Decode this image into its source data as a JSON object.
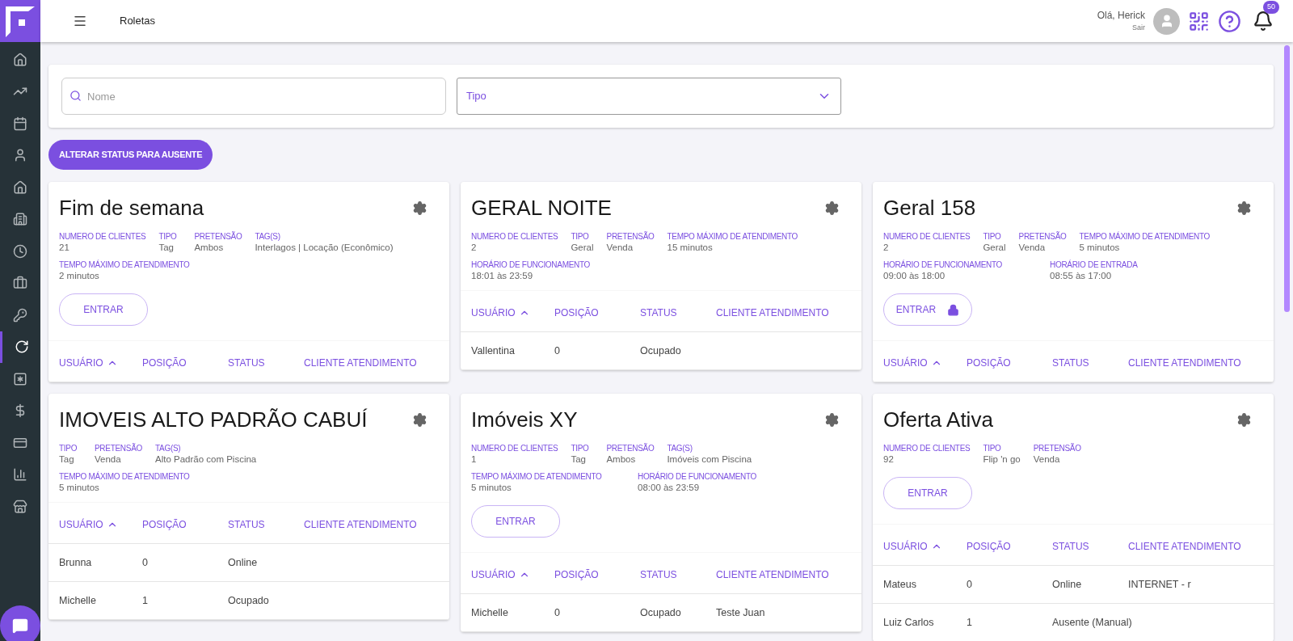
{
  "header": {
    "title": "Roletas",
    "greeting": "Olá, Herick",
    "logout": "Sair",
    "notifications": "50"
  },
  "sidebar": {
    "items": [
      {
        "selected": false
      },
      {
        "selected": false
      },
      {
        "selected": false
      },
      {
        "selected": false
      },
      {
        "selected": false
      },
      {
        "selected": false
      },
      {
        "selected": false
      },
      {
        "selected": false
      },
      {
        "selected": false
      },
      {
        "selected": true
      },
      {
        "selected": false
      },
      {
        "selected": false
      },
      {
        "selected": false
      },
      {
        "selected": false
      },
      {
        "selected": false
      }
    ]
  },
  "filters": {
    "search": {
      "placeholder": "Nome"
    },
    "type_select": {
      "placeholder": "Tipo"
    }
  },
  "status_button": "ALTERAR STATUS PARA AUSENTE",
  "cards": [
    {
      "title": "Fim de semana",
      "field_rows": [
        [
          {
            "label": "NUMERO DE CLIENTES",
            "value": "21"
          },
          {
            "label": "TIPO",
            "value": "Tag"
          },
          {
            "label": "PRETENSÃO",
            "value": "Ambos"
          },
          {
            "label": "TAG(S)",
            "value": "Interlagos | Locação (Econômico)"
          }
        ],
        [
          {
            "label": "TEMPO MÁXIMO DE ATENDIMENTO",
            "value": "2 minutos"
          }
        ]
      ],
      "enter": {
        "label": "ENTRAR",
        "locked": false
      },
      "columns": [
        {
          "label": "USUÁRIO",
          "sorted": true
        },
        {
          "label": "POSIÇÃO",
          "sorted": false
        },
        {
          "label": "STATUS",
          "sorted": false
        },
        {
          "label": "CLIENTE ATENDIMENTO",
          "sorted": false
        }
      ]
    },
    {
      "title": "GERAL NOITE",
      "field_rows": [
        [
          {
            "label": "NUMERO DE CLIENTES",
            "value": "2"
          },
          {
            "label": "TIPO",
            "value": "Geral"
          },
          {
            "label": "PRETENSÃO",
            "value": "Venda"
          },
          {
            "label": "TEMPO MÁXIMO DE ATENDIMENTO",
            "value": "15 minutos"
          }
        ],
        [
          {
            "label": "HORÁRIO DE FUNCIONAMENTO",
            "value": "18:01 às 23:59"
          }
        ]
      ],
      "columns": [
        {
          "label": "USUÁRIO",
          "sorted": true
        },
        {
          "label": "POSIÇÃO",
          "sorted": false
        },
        {
          "label": "STATUS",
          "sorted": false
        },
        {
          "label": "CLIENTE ATENDIMENTO",
          "sorted": false
        }
      ],
      "rows": [
        [
          "Vallentina",
          "0",
          "Ocupado",
          ""
        ]
      ]
    },
    {
      "title": "Geral 158",
      "field_rows": [
        [
          {
            "label": "NUMERO DE CLIENTES",
            "value": "2"
          },
          {
            "label": "TIPO",
            "value": "Geral"
          },
          {
            "label": "PRETENSÃO",
            "value": "Venda"
          },
          {
            "label": "TEMPO MÁXIMO DE ATENDIMENTO",
            "value": "5 minutos"
          }
        ],
        [
          {
            "label": "HORÁRIO DE FUNCIONAMENTO",
            "value": "09:00 às 18:00"
          },
          {
            "label": "HORÁRIO DE ENTRADA",
            "value": "08:55 às 17:00"
          }
        ]
      ],
      "enter": {
        "label": "ENTRAR",
        "locked": true
      },
      "columns": [
        {
          "label": "USUÁRIO",
          "sorted": true
        },
        {
          "label": "POSIÇÃO",
          "sorted": false
        },
        {
          "label": "STATUS",
          "sorted": false
        },
        {
          "label": "CLIENTE ATENDIMENTO",
          "sorted": false
        }
      ]
    },
    {
      "title": "IMOVEIS ALTO PADRÃO CABUÍ",
      "field_rows": [
        [
          {
            "label": "TIPO",
            "value": "Tag"
          },
          {
            "label": "PRETENSÃO",
            "value": "Venda"
          },
          {
            "label": "TAG(S)",
            "value": "Alto Padrão com Piscina"
          }
        ],
        [
          {
            "label": "TEMPO MÁXIMO DE ATENDIMENTO",
            "value": "5 minutos"
          }
        ]
      ],
      "columns": [
        {
          "label": "USUÁRIO",
          "sorted": true
        },
        {
          "label": "POSIÇÃO",
          "sorted": false
        },
        {
          "label": "STATUS",
          "sorted": false
        },
        {
          "label": "CLIENTE ATENDIMENTO",
          "sorted": false
        }
      ],
      "rows": [
        [
          "Brunna",
          "0",
          "Online",
          ""
        ],
        [
          "Michelle",
          "1",
          "Ocupado",
          ""
        ]
      ]
    },
    {
      "title": "Imóveis XY",
      "field_rows": [
        [
          {
            "label": "NUMERO DE CLIENTES",
            "value": "1"
          },
          {
            "label": "TIPO",
            "value": "Tag"
          },
          {
            "label": "PRETENSÃO",
            "value": "Ambos"
          },
          {
            "label": "TAG(S)",
            "value": "Imóveis com Piscina"
          }
        ],
        [
          {
            "label": "TEMPO MÁXIMO DE ATENDIMENTO",
            "value": "5 minutos"
          },
          {
            "label": "HORÁRIO DE FUNCIONAMENTO",
            "value": "08:00 às 23:59"
          }
        ]
      ],
      "enter": {
        "label": "ENTRAR",
        "locked": false
      },
      "columns": [
        {
          "label": "USUÁRIO",
          "sorted": true
        },
        {
          "label": "POSIÇÃO",
          "sorted": false
        },
        {
          "label": "STATUS",
          "sorted": false
        },
        {
          "label": "CLIENTE ATENDIMENTO",
          "sorted": false
        }
      ],
      "rows": [
        [
          "Michelle",
          "0",
          "Ocupado",
          "Teste Juan"
        ]
      ]
    },
    {
      "title": "Oferta Ativa",
      "field_rows": [
        [
          {
            "label": "NUMERO DE CLIENTES",
            "value": "92"
          },
          {
            "label": "TIPO",
            "value": "Flip 'n go"
          },
          {
            "label": "PRETENSÃO",
            "value": "Venda"
          }
        ]
      ],
      "enter": {
        "label": "ENTRAR",
        "locked": false
      },
      "columns": [
        {
          "label": "USUÁRIO",
          "sorted": true
        },
        {
          "label": "POSIÇÃO",
          "sorted": false
        },
        {
          "label": "STATUS",
          "sorted": false
        },
        {
          "label": "CLIENTE ATENDIMENTO",
          "sorted": false
        }
      ],
      "rows": [
        [
          "Mateus",
          "0",
          "Online",
          "INTERNET - r"
        ],
        [
          "Luiz Carlos",
          "1",
          "Ausente (Manual)",
          ""
        ]
      ]
    }
  ]
}
